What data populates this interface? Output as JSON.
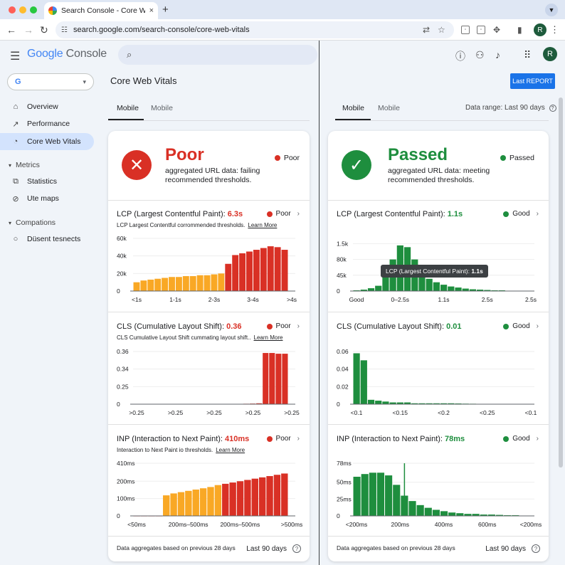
{
  "browser": {
    "tab_title": "Search Console - Core Web Vitals",
    "tab_close": "×",
    "new_tab": "+",
    "url": "search.google.com/search-console/core-web-vitals",
    "profile_initial": "R",
    "tabs_menu_icon": "chevron-down-icon"
  },
  "colors": {
    "poor": "#d93025",
    "good": "#1e8e3e",
    "orange": "#f9a825",
    "accent": "#1a73e8"
  },
  "app": {
    "logo_google": "Google",
    "logo_console": "Console",
    "search_icon": "⌕",
    "avatar": "R",
    "property": "G",
    "property_caret": "▾",
    "page_title": "Core Web Vitals",
    "last_report": "Last REPORT",
    "data_range": "Data range: Last 90 days",
    "data_range_help": "?"
  },
  "sidebar": {
    "items": [
      {
        "label": "Overview",
        "icon": "home-icon"
      },
      {
        "label": "Performance",
        "icon": "trending-icon"
      },
      {
        "label": "Core Web Vitals",
        "icon": "speed-icon"
      }
    ],
    "sections": [
      {
        "label": "Metrics",
        "items": [
          {
            "label": "Statistics"
          },
          {
            "label": "Ute maps"
          }
        ]
      },
      {
        "label": "Compations",
        "items": [
          {
            "label": "Düsent tesnects"
          }
        ]
      }
    ]
  },
  "left": {
    "tabs": [
      "Mobile",
      "Mobile"
    ],
    "status": "Poor",
    "status_desc": "aggregated URL data: failing recommended thresholds.",
    "badge": "Poor",
    "lcp": {
      "title": "LCP (Largest Contentful Paint): ",
      "value": "6.3s",
      "badge": "Poor",
      "sub": "LCP Largest Contentful corrommended thresholds.",
      "link": "Learn More"
    },
    "cls": {
      "title": "CLS (Cumulative Layout Shift): ",
      "value": "0.36",
      "badge": "Poor",
      "sub": "CLS Cumulative Layout Shift cummating layout shift..",
      "link": "Learn More"
    },
    "inp": {
      "title": "INP (Interaction to Next Paint): ",
      "value": "410ms",
      "badge": "Poor",
      "sub": "Interaction to Next Paint io thresholds.",
      "link": "Learn More"
    },
    "footer": "Data aggregates based on previous 28 days",
    "footer_right": "Last 90 days"
  },
  "right": {
    "tabs": [
      "Mobile",
      "Mobile"
    ],
    "status": "Passed",
    "status_desc": "aggregated URL data: meeting recommended thresholds.",
    "badge": "Passed",
    "lcp": {
      "title": "LCP (Largest Contentful Paint): ",
      "value": "1.1s",
      "badge": "Good"
    },
    "cls": {
      "title": "CLS (Cumulative Layout Shift): ",
      "value": "0.01",
      "badge": "Good"
    },
    "inp": {
      "title": "INP (Interaction to Next Paint): ",
      "value": "78ms",
      "badge": "Good"
    },
    "tooltip_label": "LCP (Largest Contentful Paint): ",
    "tooltip_value": "1.1s",
    "footer": "Data aggregates based on previous 28 days",
    "footer_right": "Last 90 days"
  },
  "chart_data": [
    {
      "id": "left-lcp",
      "type": "bar",
      "ylim": [
        0,
        60
      ],
      "yticks": [
        {
          "v": 0,
          "l": "0"
        },
        {
          "v": 20,
          "l": "20k"
        },
        {
          "v": 40,
          "l": "40k"
        },
        {
          "v": 60,
          "l": "60k"
        }
      ],
      "xticks": [
        "<1s",
        "1-1s",
        "2-3s",
        "3-4s",
        ">4s"
      ],
      "values": [
        10,
        12,
        13,
        14,
        15,
        16,
        16,
        17,
        17,
        18,
        18,
        19,
        20,
        31,
        41,
        43,
        45,
        47,
        49,
        51,
        50,
        47
      ],
      "colors": [
        "orange",
        "orange",
        "orange",
        "orange",
        "orange",
        "orange",
        "orange",
        "orange",
        "orange",
        "orange",
        "orange",
        "orange",
        "orange",
        "poor",
        "poor",
        "poor",
        "poor",
        "poor",
        "poor",
        "poor",
        "poor",
        "poor"
      ]
    },
    {
      "id": "left-cls",
      "type": "bar",
      "ylim": [
        0,
        0.36
      ],
      "yticks": [
        {
          "v": 0,
          "l": "0"
        },
        {
          "v": 0.12,
          "l": "0.25"
        },
        {
          "v": 0.24,
          "l": "0.34"
        },
        {
          "v": 0.36,
          "l": "0.36"
        }
      ],
      "xticks": [
        ">0.25",
        ">0.25",
        ">0.25",
        ">0.25",
        ">0.25"
      ],
      "values": [
        0.002,
        0.002,
        0.002,
        0.002,
        0.002,
        0.002,
        0.002,
        0.002,
        0.002,
        0.002,
        0.002,
        0.002,
        0.002,
        0.002,
        0.002,
        0.002,
        0.002,
        0.003,
        0.004,
        0.006,
        0.35,
        0.35,
        0.345,
        0.345
      ],
      "colors": [
        "poor",
        "poor",
        "poor",
        "poor",
        "poor",
        "poor",
        "poor",
        "poor",
        "poor",
        "poor",
        "poor",
        "poor",
        "poor",
        "poor",
        "poor",
        "poor",
        "poor",
        "poor",
        "poor",
        "poor",
        "poor",
        "poor",
        "poor",
        "poor"
      ]
    },
    {
      "id": "left-inp",
      "type": "bar",
      "ylim": [
        0,
        410
      ],
      "yticks": [
        {
          "v": 0,
          "l": "0"
        },
        {
          "v": 135,
          "l": "100ms"
        },
        {
          "v": 270,
          "l": "200ms"
        },
        {
          "v": 410,
          "l": "410ms"
        }
      ],
      "xticks": [
        "<50ms",
        "200ms–500ms",
        "200ms–500ms",
        ">500ms"
      ],
      "values": [
        0,
        0,
        0,
        0,
        160,
        175,
        185,
        195,
        205,
        215,
        225,
        240,
        250,
        260,
        270,
        280,
        290,
        300,
        310,
        320,
        330
      ],
      "colors": [
        "poor",
        "poor",
        "poor",
        "poor",
        "orange",
        "orange",
        "orange",
        "orange",
        "orange",
        "orange",
        "orange",
        "orange",
        "poor",
        "poor",
        "poor",
        "poor",
        "poor",
        "poor",
        "poor",
        "poor",
        "poor"
      ]
    },
    {
      "id": "right-lcp",
      "type": "bar",
      "ylim": [
        0,
        1.5
      ],
      "yticks": [
        {
          "v": 0,
          "l": "0"
        },
        {
          "v": 0.45,
          "l": "45k"
        },
        {
          "v": 0.9,
          "l": "80k"
        },
        {
          "v": 1.35,
          "l": "1.5k"
        }
      ],
      "xticks": [
        "Good",
        "0–2.5s",
        "1.1s",
        "2.5s",
        "2.5s"
      ],
      "values": [
        0.02,
        0.04,
        0.08,
        0.15,
        0.4,
        0.9,
        1.3,
        1.25,
        0.9,
        0.55,
        0.35,
        0.25,
        0.18,
        0.13,
        0.1,
        0.07,
        0.05,
        0.04,
        0.03,
        0.02,
        0.02,
        0.01,
        0.01,
        0.01
      ],
      "colors": [
        "good"
      ]
    },
    {
      "id": "right-cls",
      "type": "bar",
      "ylim": [
        0,
        0.06
      ],
      "yticks": [
        {
          "v": 0,
          "l": "0"
        },
        {
          "v": 0.02,
          "l": "0.02"
        },
        {
          "v": 0.04,
          "l": "0.04"
        },
        {
          "v": 0.06,
          "l": "0.06"
        }
      ],
      "xticks": [
        "<0.1",
        "<0.15",
        "<0.2",
        "<0.25",
        "<0.1"
      ],
      "values": [
        0.058,
        0.05,
        0.005,
        0.004,
        0.003,
        0.002,
        0.002,
        0.002,
        0.001,
        0.001,
        0.001,
        0.001,
        0.001,
        0.001,
        0.0008,
        0.0006,
        0.0005,
        0.0004,
        0.0003,
        0.0003,
        0.0002,
        0.0002,
        0.0001,
        0.0001
      ],
      "colors": [
        "good"
      ]
    },
    {
      "id": "right-inp",
      "type": "bar",
      "ylim": [
        0,
        78
      ],
      "yticks": [
        {
          "v": 0,
          "l": "0"
        },
        {
          "v": 25,
          "l": "25ms"
        },
        {
          "v": 50,
          "l": "50ms"
        },
        {
          "v": 78,
          "l": "78ms"
        }
      ],
      "xticks": [
        "<200ms",
        "200ms",
        "400ms",
        "600ms",
        "<200ms"
      ],
      "values": [
        58,
        62,
        64,
        64,
        60,
        46,
        30,
        22,
        16,
        12,
        9,
        7,
        5,
        4,
        3,
        3,
        2,
        2,
        1.5,
        1,
        1,
        0.5
      ],
      "colors": [
        "good"
      ],
      "marker": 6
    }
  ]
}
